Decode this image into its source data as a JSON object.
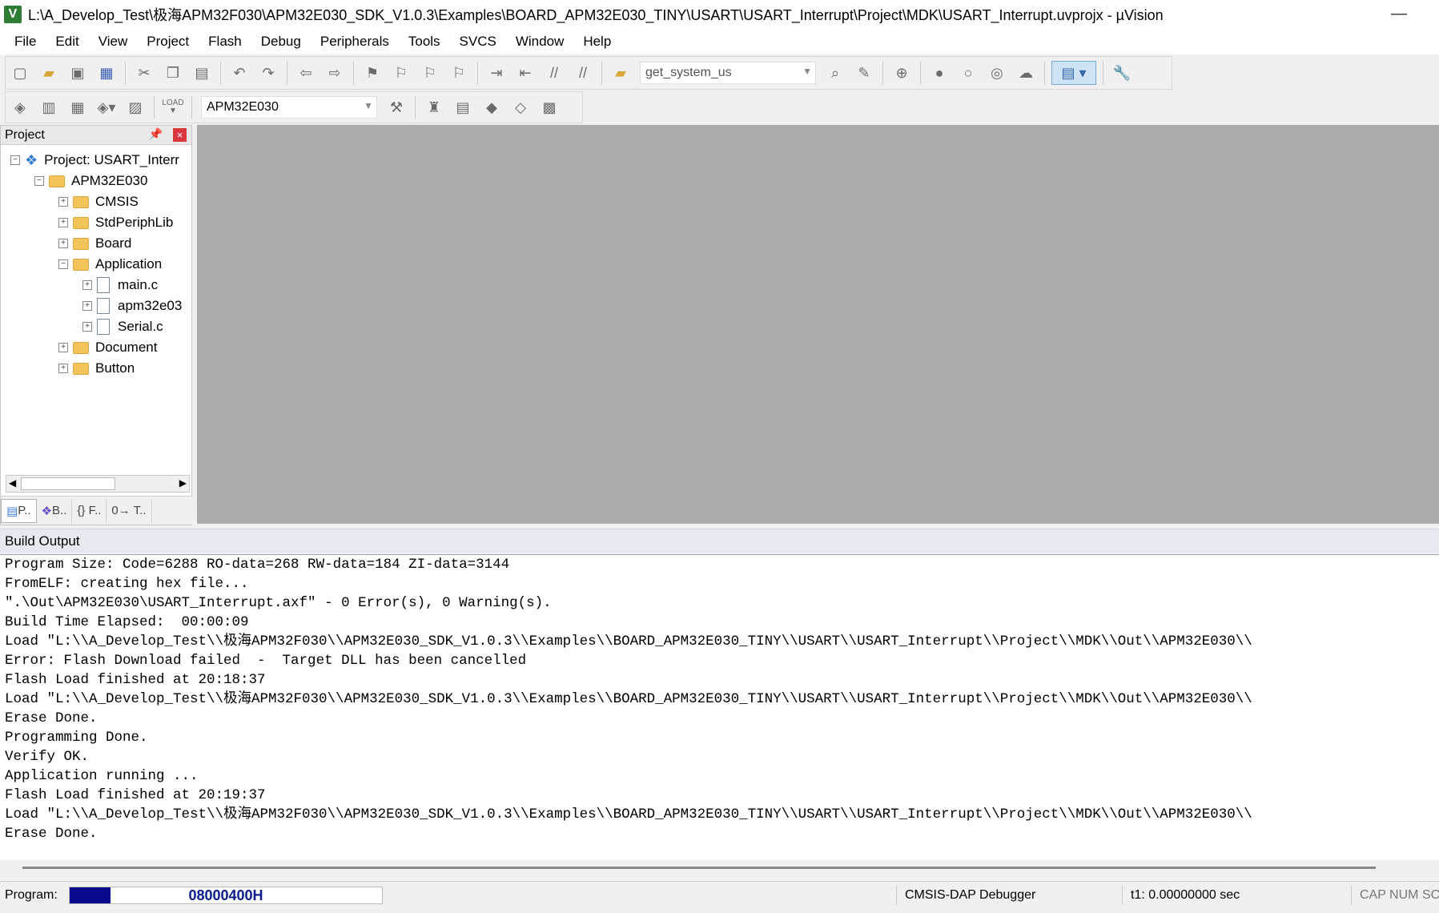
{
  "window": {
    "title": "L:\\A_Develop_Test\\极海APM32F030\\APM32E030_SDK_V1.0.3\\Examples\\BOARD_APM32E030_TINY\\USART\\USART_Interrupt\\Project\\MDK\\USART_Interrupt.uvprojx - µVision",
    "app_icon_letter": "V",
    "minimize_glyph": "—"
  },
  "menu": [
    "File",
    "Edit",
    "View",
    "Project",
    "Flash",
    "Debug",
    "Peripherals",
    "Tools",
    "SVCS",
    "Window",
    "Help"
  ],
  "toolbar": {
    "find_value": "get_system_us",
    "target_value": "APM32E030",
    "load_label": "LOAD"
  },
  "project_panel": {
    "title": "Project",
    "pin_glyph": "📌",
    "close_glyph": "×",
    "tree": [
      {
        "label": "Project: USART_Interr",
        "level": 0,
        "type": "project",
        "expander": "−"
      },
      {
        "label": "APM32E030",
        "level": 1,
        "type": "target",
        "expander": "−"
      },
      {
        "label": "CMSIS",
        "level": 2,
        "type": "folder",
        "expander": "+"
      },
      {
        "label": "StdPeriphLib",
        "level": 2,
        "type": "folder",
        "expander": "+"
      },
      {
        "label": "Board",
        "level": 2,
        "type": "folder",
        "expander": "+"
      },
      {
        "label": "Application",
        "level": 2,
        "type": "folder-open",
        "expander": "−"
      },
      {
        "label": "main.c",
        "level": 3,
        "type": "file",
        "expander": "+"
      },
      {
        "label": "apm32e03",
        "level": 3,
        "type": "file",
        "expander": "+"
      },
      {
        "label": "Serial.c",
        "level": 3,
        "type": "file",
        "expander": "+"
      },
      {
        "label": "Document",
        "level": 2,
        "type": "folder",
        "expander": "+"
      },
      {
        "label": "Button",
        "level": 2,
        "type": "folder",
        "expander": "+"
      }
    ],
    "tabs": [
      "P..",
      "B..",
      "{} F..",
      "0→ T.."
    ]
  },
  "build_output": {
    "title": "Build Output",
    "lines": [
      "Program Size: Code=6288 RO-data=268 RW-data=184 ZI-data=3144",
      "FromELF: creating hex file...",
      "\".\\Out\\APM32E030\\USART_Interrupt.axf\" - 0 Error(s), 0 Warning(s).",
      "Build Time Elapsed:  00:00:09",
      "Load \"L:\\\\A_Develop_Test\\\\极海APM32F030\\\\APM32E030_SDK_V1.0.3\\\\Examples\\\\BOARD_APM32E030_TINY\\\\USART\\\\USART_Interrupt\\\\Project\\\\MDK\\\\Out\\\\APM32E030\\\\",
      "Error: Flash Download failed  -  Target DLL has been cancelled",
      "Flash Load finished at 20:18:37",
      "Load \"L:\\\\A_Develop_Test\\\\极海APM32F030\\\\APM32E030_SDK_V1.0.3\\\\Examples\\\\BOARD_APM32E030_TINY\\\\USART\\\\USART_Interrupt\\\\Project\\\\MDK\\\\Out\\\\APM32E030\\\\",
      "Erase Done.",
      "Programming Done.",
      "Verify OK.",
      "Application running ...",
      "Flash Load finished at 20:19:37",
      "Load \"L:\\\\A_Develop_Test\\\\极海APM32F030\\\\APM32E030_SDK_V1.0.3\\\\Examples\\\\BOARD_APM32E030_TINY\\\\USART\\\\USART_Interrupt\\\\Project\\\\MDK\\\\Out\\\\APM32E030\\\\",
      "Erase Done."
    ]
  },
  "status": {
    "program_label": "Program:",
    "progress_text": "08000400H",
    "progress_fraction": 0.13,
    "debugger": "CMSIS-DAP Debugger",
    "time": "t1: 0.00000000 sec",
    "indicators": "CAP NUM SCRL"
  }
}
